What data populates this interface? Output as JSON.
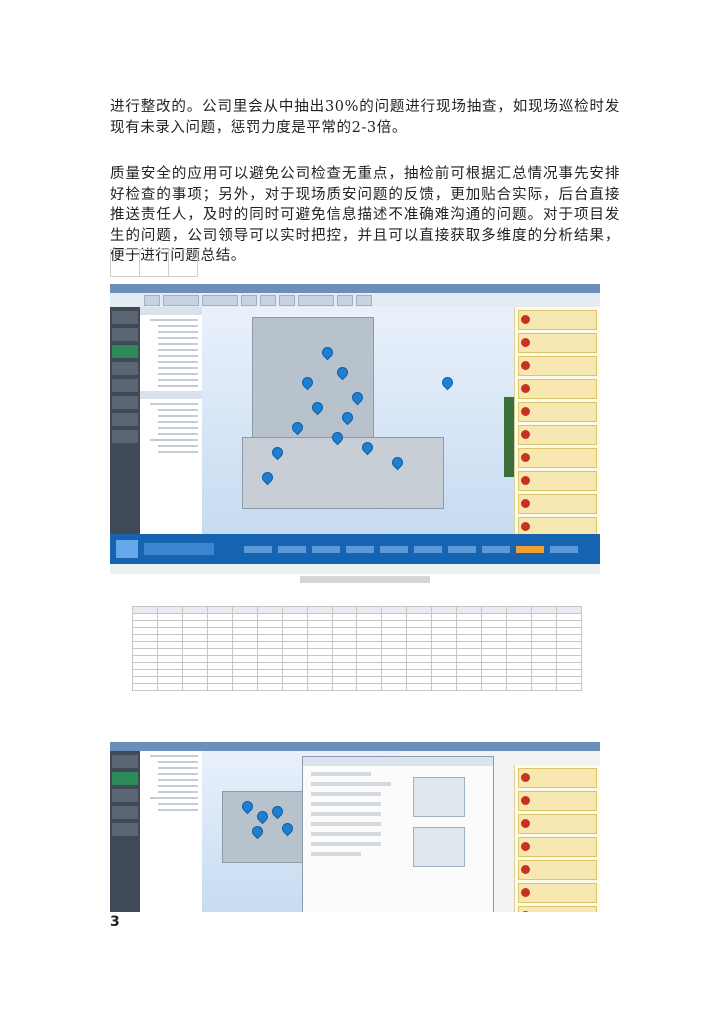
{
  "paragraphs": [
    "进行整改的。公司里会从中抽出30%的问题进行现场抽查，如现场巡检时发现有未录入问题，惩罚力度是平常的2-3倍。",
    "质量安全的应用可以避免公司检查无重点，抽检前可根据汇总情况事先安排好检查的事项；另外，对于现场质安问题的反馈，更加贴合实际，后台直接推送责任人，及时的同时可避免信息描述不准确难沟通的问题。对于项目发生的问题，公司领导可以实时把控，并且可以直接获取多维度的分析结果，便于进行问题总结。"
  ],
  "page_number": "3",
  "colors": {
    "app_blue": "#1664b1",
    "issue_red": "#c9321f",
    "pin_blue": "#1f7fd1",
    "active_green": "#2e8b57"
  }
}
